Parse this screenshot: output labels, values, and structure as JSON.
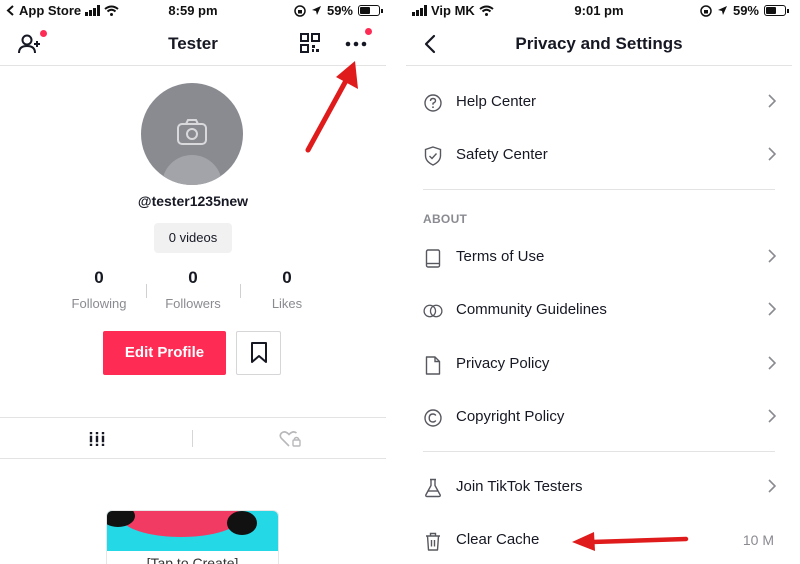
{
  "left": {
    "status": {
      "carrier": "App Store",
      "time": "8:59 pm",
      "battery": "59%"
    },
    "header": {
      "title": "Tester"
    },
    "profile": {
      "username": "@tester1235new",
      "videos": "0 videos",
      "stats": [
        {
          "value": "0",
          "label": "Following"
        },
        {
          "value": "0",
          "label": "Followers"
        },
        {
          "value": "0",
          "label": "Likes"
        }
      ]
    },
    "actions": {
      "edit_label": "Edit Profile"
    },
    "card": {
      "text": "[Tap to Create]"
    }
  },
  "right": {
    "status": {
      "carrier": "Vip MK",
      "time": "9:01 pm",
      "battery": "59%"
    },
    "header": {
      "title": "Privacy and Settings"
    },
    "items": [
      {
        "label": "Help Center",
        "icon": "help-icon"
      },
      {
        "label": "Safety Center",
        "icon": "shield-icon"
      }
    ],
    "about": {
      "heading": "ABOUT",
      "items": [
        {
          "label": "Terms of Use",
          "icon": "book-icon"
        },
        {
          "label": "Community Guidelines",
          "icon": "rings-icon"
        },
        {
          "label": "Privacy Policy",
          "icon": "document-icon"
        },
        {
          "label": "Copyright Policy",
          "icon": "copyright-icon"
        }
      ]
    },
    "more": [
      {
        "label": "Join TikTok Testers",
        "icon": "flask-icon"
      },
      {
        "label": "Clear Cache",
        "icon": "trash-icon",
        "value": "10 M"
      }
    ]
  },
  "colors": {
    "accent": "#fe2c55",
    "annotation_arrow": "#e01b1b",
    "secondary_text": "#8a8b91"
  }
}
